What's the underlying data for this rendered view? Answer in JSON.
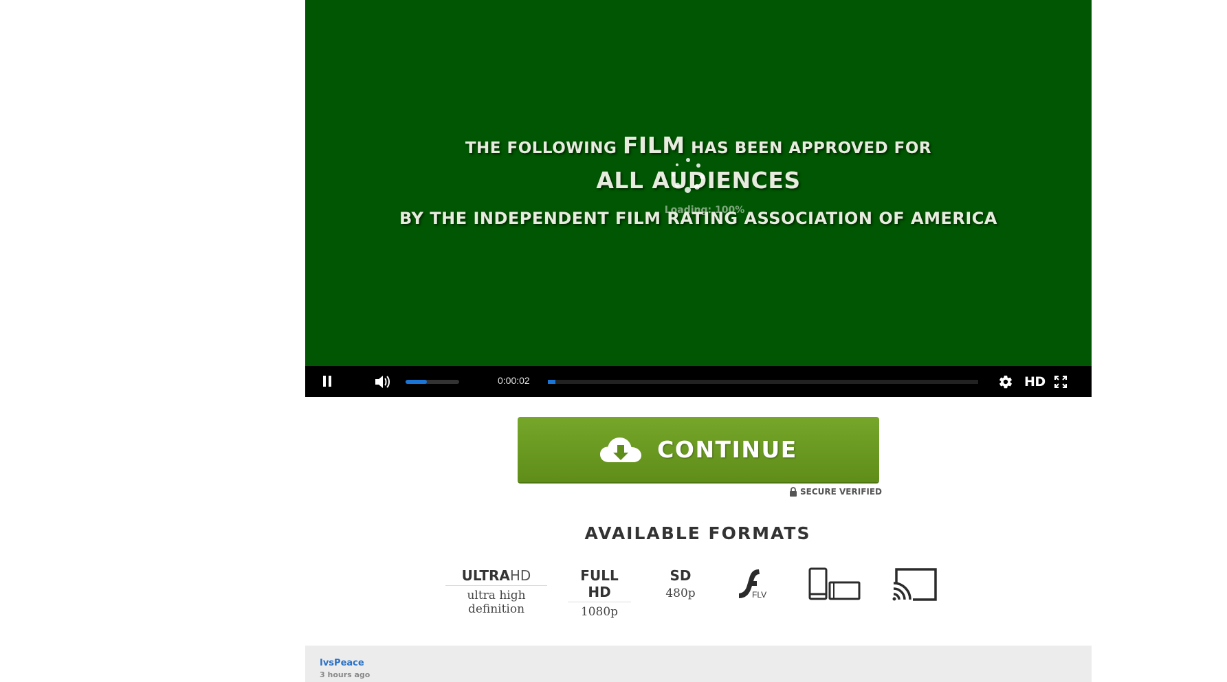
{
  "player": {
    "title_card": {
      "line1_pre": "THE FOLLOWING ",
      "line1_big": "FILM",
      "line1_post": " HAS BEEN APPROVED FOR",
      "line2": "ALL AUDIENCES",
      "line3": "BY THE INDEPENDENT FILM RATING ASSOCIATION OF AMERICA"
    },
    "loading_text": "Loading: 100%",
    "time": "0:00:02",
    "volume_level": 0.4,
    "progress_level": 0.018,
    "quality_label": "HD",
    "video_bg_color": "#005602",
    "accent_color": "#1a75d6"
  },
  "continue": {
    "label": "CONTINUE",
    "color": "#6b9b22"
  },
  "secure": {
    "label": "SECURE VERIFIED"
  },
  "formats": {
    "title": "AVAILABLE FORMATS",
    "ultra_bold": "ULTRA",
    "ultra_thin": "HD",
    "ultra_sub": "ultra high definition",
    "fullhd_main": "FULL HD",
    "fullhd_sub": "1080p",
    "sd_main": "SD",
    "sd_sub": "480p",
    "flv_label": "FLV",
    "icons": [
      "flash-flv-icon",
      "devices-icon",
      "cast-icon"
    ]
  },
  "comment": {
    "user": "IvsPeace",
    "time_ago": "3 hours ago"
  }
}
